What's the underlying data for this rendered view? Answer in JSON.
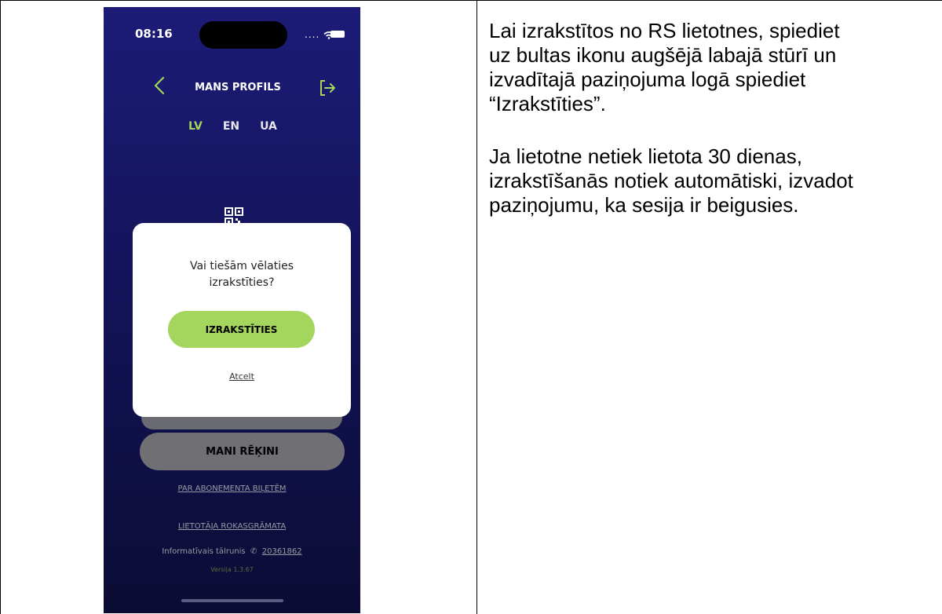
{
  "phone": {
    "status_time": "08:16",
    "status_dots": "....",
    "header_title": "MANS PROFILS",
    "languages": [
      "LV",
      "EN",
      "UA"
    ],
    "active_language": "LV",
    "invoices_button": "MANI RĒĶINI",
    "subscription_link": "PAR ABONEMENTA BIĻETĒM",
    "manual_link": "LIETOTĀJA ROKASGRĀMATA",
    "info_label": "Informatīvais tālrunis",
    "info_phone": "20361862",
    "version": "Versija 1.3.67",
    "accent_color": "#a4d65e",
    "icons": [
      "back-chevron-icon",
      "logout-arrow-icon",
      "qr-code-icon",
      "phone-icon",
      "wifi-icon",
      "battery-icon"
    ]
  },
  "dialog": {
    "message": "Vai tiešām vēlaties\nizrakstīties?",
    "confirm_label": "IZRAKSTĪTIES",
    "cancel_label": "Atcelt"
  },
  "instructions": {
    "paragraph1": "Lai izrakstītos no RS lietotnes, spiediet\nuz bultas ikonu augšējā labajā stūrī un\nizvadītajā paziņojuma logā spiediet\n“Izrakstīties”.",
    "paragraph2": "Ja lietotne netiek lietota 30 dienas,\nizrakstīšanās notiek automātiski, izvadot\npaziņojumu, ka sesija ir beigusies."
  }
}
